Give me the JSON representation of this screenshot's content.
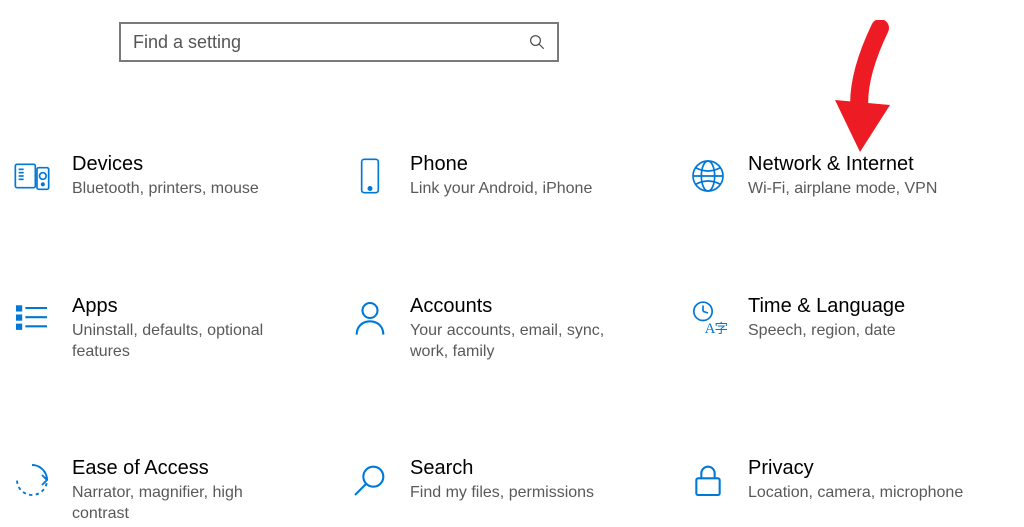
{
  "search": {
    "placeholder": "Find a setting"
  },
  "tiles": {
    "devices": {
      "title": "Devices",
      "sub": "Bluetooth, printers, mouse"
    },
    "phone": {
      "title": "Phone",
      "sub": "Link your Android, iPhone"
    },
    "network": {
      "title": "Network & Internet",
      "sub": "Wi-Fi, airplane mode, VPN"
    },
    "apps": {
      "title": "Apps",
      "sub": "Uninstall, defaults, optional features"
    },
    "accounts": {
      "title": "Accounts",
      "sub": "Your accounts, email, sync, work, family"
    },
    "time": {
      "title": "Time & Language",
      "sub": "Speech, region, date"
    },
    "ease": {
      "title": "Ease of Access",
      "sub": "Narrator, magnifier, high contrast"
    },
    "searchtile": {
      "title": "Search",
      "sub": "Find my files, permissions"
    },
    "privacy": {
      "title": "Privacy",
      "sub": "Location, camera, microphone"
    }
  },
  "colors": {
    "accent": "#0078d7",
    "arrow": "#ed1c24"
  }
}
